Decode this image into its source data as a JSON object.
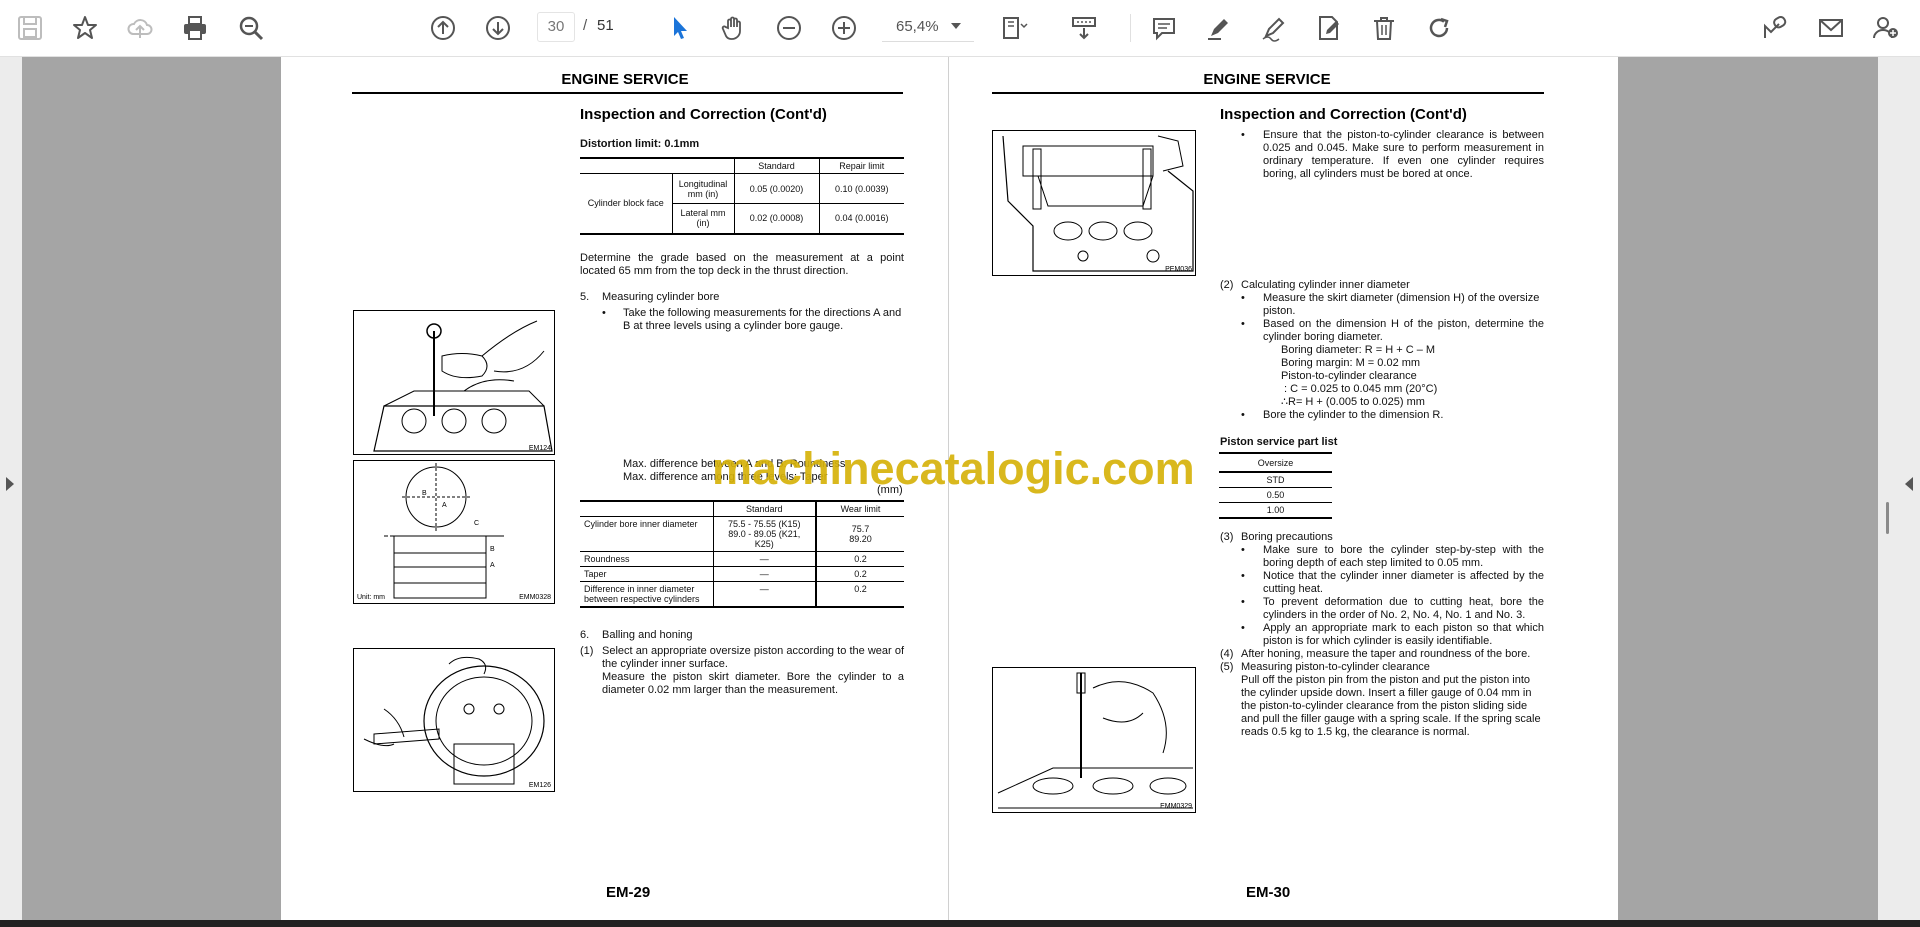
{
  "toolbar": {
    "current_page": "30",
    "page_separator": "/",
    "total_pages": "51",
    "zoom": "65,4%"
  },
  "watermark": "machinecatalogic.com",
  "left_page": {
    "header": "ENGINE SERVICE",
    "title": "Inspection and Correction (Cont'd)",
    "distortion_label": "Distortion limit: 0.1mm",
    "distortion_table": {
      "head_standard": "Standard",
      "head_repair": "Repair limit",
      "row_group": "Cylinder block face",
      "rows": [
        {
          "dir": "Longitudinal mm (in)",
          "standard": "0.05 (0.0020)",
          "repair": "0.10 (0.0039)"
        },
        {
          "dir": "Lateral mm (in)",
          "standard": "0.02 (0.0008)",
          "repair": "0.04 (0.0016)"
        }
      ]
    },
    "grade_text": "Determine the grade based on the measurement at a point located 65 mm from the top deck in the thrust direction.",
    "step5_num": "5.",
    "step5_title": "Measuring cylinder bore",
    "step5_bullet": "Take the following measurements for the directions A and B at three levels using a cylinder bore gauge.",
    "maxdiff1": "Max. difference between A and B: Roundness",
    "maxdiff2": "Max. difference among three levels: Taper",
    "unit": "(mm)",
    "bore_table": {
      "head_standard": "Standard",
      "head_wear": "Wear limit",
      "rows": [
        {
          "item": "Cylinder bore inner diameter",
          "standard": "75.5 - 75.55 (K15)\n89.0 - 89.05 (K21, K25)",
          "wear": "75.7\n89.20"
        },
        {
          "item": "Roundness",
          "standard": "—",
          "wear": "0.2"
        },
        {
          "item": "Taper",
          "standard": "—",
          "wear": "0.2"
        },
        {
          "item": "Difference in inner diameter between respective cylinders",
          "standard": "—",
          "wear": "0.2"
        }
      ]
    },
    "step6_num": "6.",
    "step6_title": "Balling and honing",
    "step6_1_num": "(1)",
    "step6_1_text": "Select an appropriate oversize piston according to the wear of the cylinder inner surface.",
    "step6_1_text2": "Measure the piston skirt diameter. Bore the cylinder to a diameter 0.02 mm larger than the measurement.",
    "fig1_label": "EM124",
    "fig2_label": "EMM0328",
    "fig2_unit": "Unit: mm",
    "fig3_label": "EM126",
    "page_number": "EM-29"
  },
  "right_page": {
    "header": "ENGINE SERVICE",
    "title": "Inspection and Correction (Cont'd)",
    "intro_bullet": "Ensure that the piston-to-cylinder clearance is between 0.025 and 0.045. Make sure to perform measurement in ordinary temperature. If even one cylinder requires boring, all cylinders must be bored at once.",
    "s2_num": "(2)",
    "s2_title": "Calculating cylinder inner diameter",
    "s2_b1": "Measure the skirt diameter (dimension H) of the oversize piston.",
    "s2_b2": "Based on the dimension H of the piston, determine the cylinder boring diameter.",
    "f1": "Boring diameter: R = H + C – M",
    "f2": "Boring margin: M = 0.02 mm",
    "f3": "Piston-to-cylinder clearance",
    "f4": ": C = 0.025 to 0.045 mm (20°C)",
    "f5": "∴R= H + (0.005 to 0.025) mm",
    "s2_b3": "Bore the cylinder to the dimension R.",
    "piston_list_title": "Piston service part list",
    "piston_table_head": "Oversize",
    "piston_rows": [
      "STD",
      "0.50",
      "1.00"
    ],
    "s3_num": "(3)",
    "s3_title": "Boring precautions",
    "s3_b1": "Make sure to bore the cylinder step-by-step with the boring depth of each step limited to 0.05 mm.",
    "s3_b2": "Notice that the cylinder inner diameter is affected by the cutting heat.",
    "s3_b3": "To prevent deformation due to cutting heat, bore the cylinders in the order of No. 2, No. 4, No. 1 and No. 3.",
    "s3_b4": "Apply an appropriate mark to each piston so that which piston is for which cylinder is easily identifiable.",
    "s4_num": "(4)",
    "s4_text": "After honing, measure the taper and roundness of the bore.",
    "s5_num": "(5)",
    "s5_title": "Measuring piston-to-cylinder clearance",
    "s5_text": "Pull off the piston pin from the piston and put the piston into the cylinder upside down. Insert a filler gauge of 0.04 mm in the piston-to-cylinder clearance from the piston sliding side and pull the filler gauge with a spring scale. If the spring scale reads 0.5 kg to 1.5 kg, the clearance is normal.",
    "fig1_label": "PEM036",
    "fig2_label": "EMM0329",
    "page_number": "EM-30"
  }
}
